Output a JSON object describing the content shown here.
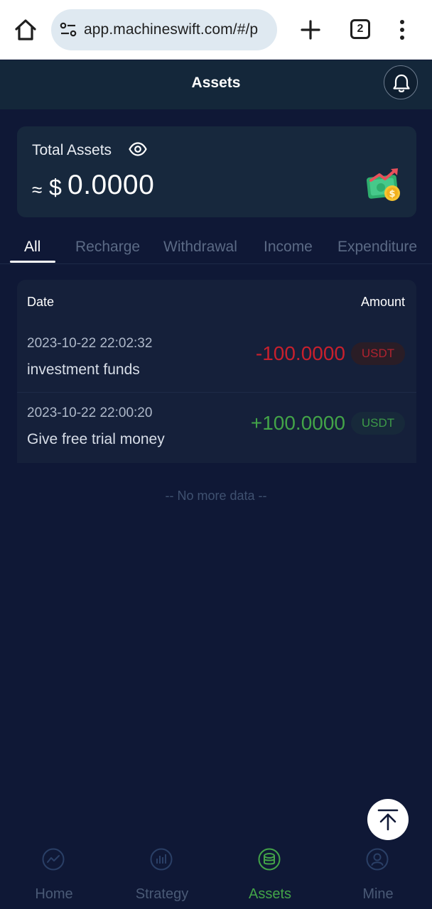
{
  "browser": {
    "url": "app.machineswift.com/#/p",
    "tab_count": "2"
  },
  "header": {
    "title": "Assets"
  },
  "summary": {
    "label": "Total Assets",
    "approx_symbol": "≈",
    "currency_symbol": "$",
    "value": "0.0000"
  },
  "tabs": [
    {
      "label": "All",
      "active": true
    },
    {
      "label": "Recharge",
      "active": false
    },
    {
      "label": "Withdrawal",
      "active": false
    },
    {
      "label": "Income",
      "active": false
    },
    {
      "label": "Expenditure",
      "active": false
    }
  ],
  "table": {
    "date_header": "Date",
    "amount_header": "Amount",
    "rows": [
      {
        "datetime": "2023-10-22 22:02:32",
        "description": "investment funds",
        "amount": "-100.0000",
        "unit": "USDT",
        "direction": "out"
      },
      {
        "datetime": "2023-10-22 22:00:20",
        "description": "Give free trial money",
        "amount": "+100.0000",
        "unit": "USDT",
        "direction": "in"
      }
    ]
  },
  "footer_note": "-- No more data --",
  "nav": [
    {
      "label": "Home",
      "icon": "chart-line-icon",
      "active": false
    },
    {
      "label": "Strategy",
      "icon": "bar-chart-icon",
      "active": false
    },
    {
      "label": "Assets",
      "icon": "coin-stack-icon",
      "active": true
    },
    {
      "label": "Mine",
      "icon": "user-icon",
      "active": false
    }
  ],
  "colors": {
    "background": "#0f1836",
    "card": "#17283d",
    "negative": "#c8202d",
    "positive": "#43a448",
    "active_nav": "#43a448"
  }
}
